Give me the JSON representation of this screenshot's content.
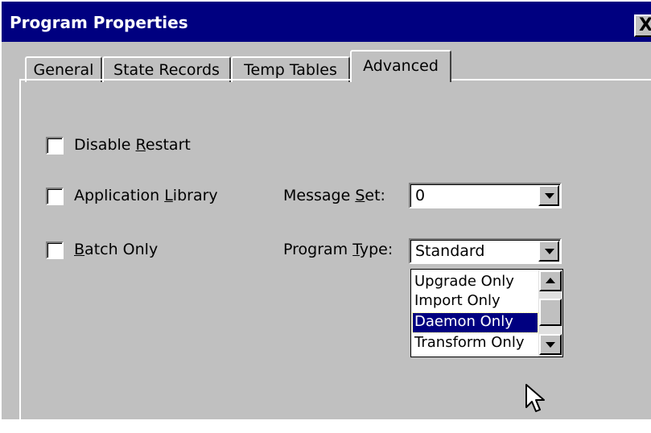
{
  "window": {
    "title": "Program Properties",
    "close_label": "X"
  },
  "tabs": [
    {
      "label": "General"
    },
    {
      "label": "State Records"
    },
    {
      "label": "Temp Tables"
    },
    {
      "label": "Advanced",
      "active": true
    }
  ],
  "checkboxes": {
    "disable_restart": {
      "label_pre": "Disable ",
      "mnemonic": "R",
      "label_post": "estart",
      "checked": false
    },
    "application_library": {
      "label_pre": "Application ",
      "mnemonic": "L",
      "label_post": "ibrary",
      "checked": false
    },
    "batch_only": {
      "label_pre": "",
      "mnemonic": "B",
      "label_post": "atch Only",
      "checked": false
    }
  },
  "message_set": {
    "label_pre": "Message ",
    "mnemonic": "S",
    "label_post": "et:",
    "value": "0"
  },
  "program_type": {
    "label_pre": "Program ",
    "mnemonic": "T",
    "label_post": "ype:",
    "value": "Standard",
    "options": [
      "Upgrade Only",
      "Import Only",
      "Daemon Only",
      "Transform Only"
    ],
    "highlighted": "Daemon Only"
  },
  "icons": [
    "close-icon",
    "chevron-down-icon",
    "scroll-up-icon",
    "scroll-down-icon",
    "mouse-cursor-icon"
  ]
}
